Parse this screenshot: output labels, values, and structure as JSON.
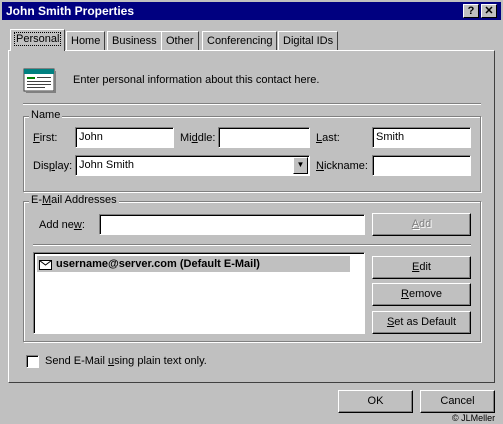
{
  "window": {
    "title": "John Smith Properties",
    "help_glyph": "?",
    "close_glyph": "✕"
  },
  "tabs": [
    {
      "label": "Personal",
      "active": true
    },
    {
      "label": "Home"
    },
    {
      "label": "Business"
    },
    {
      "label": "Other"
    },
    {
      "label": "Conferencing"
    },
    {
      "label": "Digital IDs"
    }
  ],
  "intro": {
    "text": "Enter personal information about this contact here.",
    "icon": "contact-card-icon"
  },
  "name_group": {
    "label": "Name",
    "first_label": "First:",
    "first_value": "John",
    "middle_label": "Middle:",
    "middle_value": "",
    "last_label": "Last:",
    "last_value": "Smith",
    "display_label": "Display:",
    "display_value": "John Smith",
    "nickname_label": "Nickname:",
    "nickname_value": ""
  },
  "email_group": {
    "label": "E-Mail Addresses",
    "add_new_label": "Add new:",
    "add_new_value": "",
    "add_button": "Add",
    "addresses": [
      {
        "text": "username@server.com  (Default E-Mail)"
      }
    ],
    "edit_button": "Edit",
    "remove_button": "Remove",
    "set_default_button": "Set as Default"
  },
  "plain_text_checkbox": {
    "label": "Send E-Mail using plain text only.",
    "checked": false
  },
  "footer": {
    "ok_button": "OK",
    "cancel_button": "Cancel",
    "credit": "© JLMeller"
  }
}
